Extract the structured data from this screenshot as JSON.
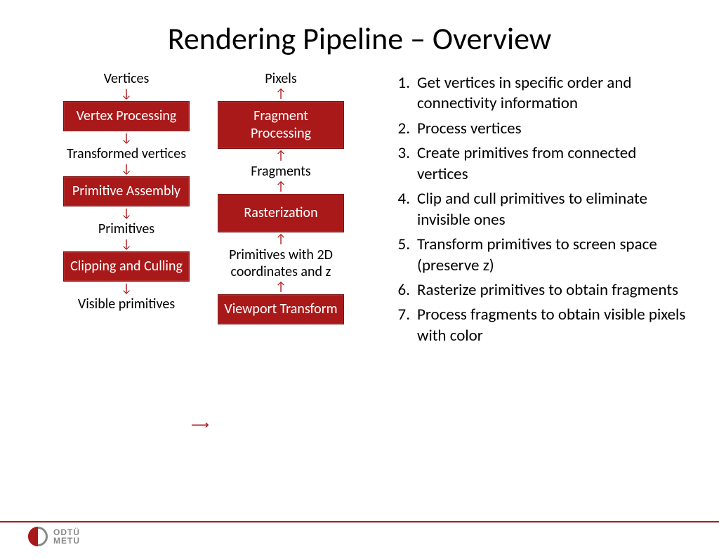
{
  "title": "Rendering Pipeline – Overview",
  "diagram": {
    "col1": {
      "top_label": "Vertices",
      "box1": "Vertex Processing",
      "mid1": "Transformed vertices",
      "box2": "Primitive Assembly",
      "mid2": "Primitives",
      "box3": "Clipping and Culling",
      "bottom_label": "Visible primitives"
    },
    "col2": {
      "top_label": "Pixels",
      "box1": "Fragment Processing",
      "mid1": "Fragments",
      "box2": "Rasterization",
      "mid2": "Primitives with 2D coordinates and z",
      "box3": "Viewport Transform"
    }
  },
  "steps": [
    "Get vertices in specific order and connectivity information",
    "Process vertices",
    "Create primitives from connected vertices",
    "Clip and cull primitives to eliminate invisible ones",
    "Transform primitives to screen space (preserve z)",
    "Rasterize primitives to obtain fragments",
    "Process fragments to obtain visible pixels with color"
  ],
  "logo": {
    "line1": "ODTÜ",
    "line2": "METU"
  }
}
